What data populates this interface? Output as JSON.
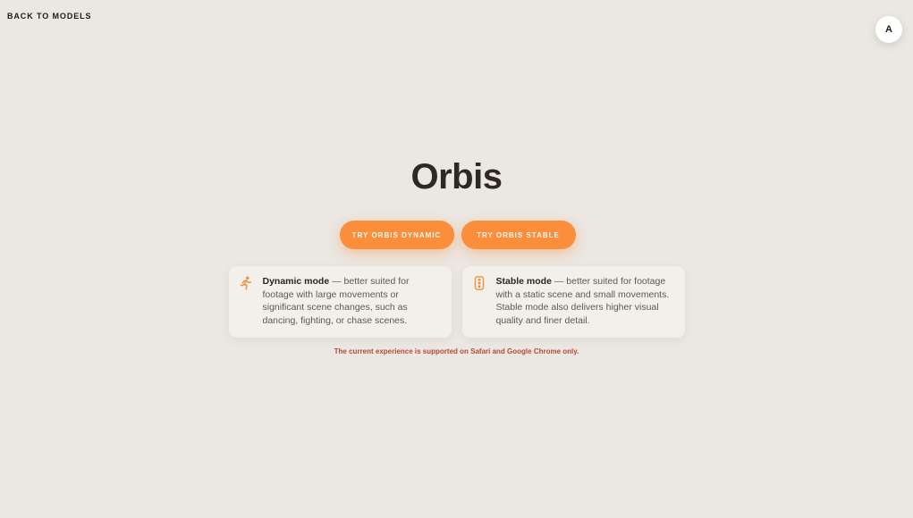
{
  "nav": {
    "back_label": "BACK TO MODELS"
  },
  "user": {
    "avatar_initial": "A"
  },
  "page": {
    "title": "Orbis"
  },
  "actions": {
    "dynamic_label": "TRY ORBIS DYNAMIC",
    "stable_label": "TRY ORBIS STABLE"
  },
  "modes": [
    {
      "icon": "running-person-icon",
      "name": "Dynamic mode",
      "description": " — better suited for footage with large movements or significant scene changes, such as dancing, fighting, or chase scenes."
    },
    {
      "icon": "traffic-light-icon",
      "name": "Stable mode",
      "description": " — better suited for footage with a static scene and small movements. Stable mode also delivers higher visual quality and finer detail."
    }
  ],
  "notice": "The current experience is supported on Safari and Google Chrome only.",
  "colors": {
    "background": "#ebe7e2",
    "accent": "#fb8e3b",
    "notice": "#b34a36"
  }
}
